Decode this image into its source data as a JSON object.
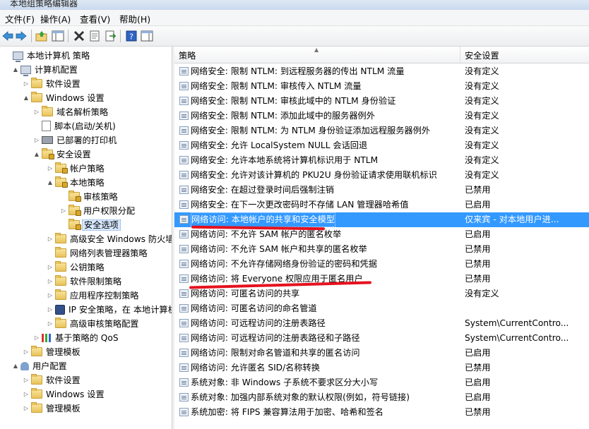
{
  "window": {
    "title": "本地组策略编辑器"
  },
  "menu": [
    "文件(F)",
    "操作(A)",
    "查看(V)",
    "帮助(H)"
  ],
  "toolbar_icons": [
    "back-arrow-icon",
    "forward-arrow-icon",
    "up-folder-icon",
    "show-tree-icon",
    "delete-icon",
    "properties-icon",
    "export-icon",
    "help-icon",
    "show-action-pane-icon"
  ],
  "tree": [
    {
      "label": "本地计算机 策略",
      "level": 0,
      "icon": "comp",
      "exp": ""
    },
    {
      "label": "计算机配置",
      "level": 1,
      "icon": "comp",
      "exp": "▲"
    },
    {
      "label": "软件设置",
      "level": 2,
      "icon": "folder",
      "exp": "▷"
    },
    {
      "label": "Windows 设置",
      "level": 2,
      "icon": "folder",
      "exp": "▲"
    },
    {
      "label": "域名解析策略",
      "level": 3,
      "icon": "folder",
      "exp": "▷"
    },
    {
      "label": "脚本(启动/关机)",
      "level": 3,
      "icon": "doc",
      "exp": ""
    },
    {
      "label": "已部署的打印机",
      "level": 3,
      "icon": "printer",
      "exp": "▷"
    },
    {
      "label": "安全设置",
      "level": 3,
      "icon": "lockf",
      "exp": "▲"
    },
    {
      "label": "帐户策略",
      "level": 4,
      "icon": "lockf",
      "exp": "▷"
    },
    {
      "label": "本地策略",
      "level": 4,
      "icon": "lockf",
      "exp": "▲"
    },
    {
      "label": "审核策略",
      "level": 5,
      "icon": "lockf",
      "exp": ""
    },
    {
      "label": "用户权限分配",
      "level": 5,
      "icon": "lockf",
      "exp": "▷"
    },
    {
      "label": "安全选项",
      "level": 5,
      "icon": "lockf",
      "exp": "",
      "selected": true
    },
    {
      "label": "高级安全 Windows 防火墙",
      "level": 4,
      "icon": "folder",
      "exp": "▷"
    },
    {
      "label": "网络列表管理器策略",
      "level": 4,
      "icon": "folder",
      "exp": ""
    },
    {
      "label": "公钥策略",
      "level": 4,
      "icon": "folder",
      "exp": "▷"
    },
    {
      "label": "软件限制策略",
      "level": 4,
      "icon": "folder",
      "exp": "▷"
    },
    {
      "label": "应用程序控制策略",
      "level": 4,
      "icon": "folder",
      "exp": "▷"
    },
    {
      "label": "IP 安全策略，在 本地计算机",
      "level": 4,
      "icon": "ipsec",
      "exp": "▷"
    },
    {
      "label": "高级审核策略配置",
      "level": 4,
      "icon": "folder",
      "exp": "▷"
    },
    {
      "label": "基于策略的 QoS",
      "level": 3,
      "icon": "chart",
      "exp": "▷"
    },
    {
      "label": "管理模板",
      "level": 2,
      "icon": "folder",
      "exp": "▷"
    },
    {
      "label": "用户配置",
      "level": 1,
      "icon": "user",
      "exp": "▲"
    },
    {
      "label": "软件设置",
      "level": 2,
      "icon": "folder",
      "exp": "▷"
    },
    {
      "label": "Windows 设置",
      "level": 2,
      "icon": "folder",
      "exp": "▷"
    },
    {
      "label": "管理模板",
      "level": 2,
      "icon": "folder",
      "exp": "▷"
    }
  ],
  "list": {
    "columns": [
      "策略",
      "安全设置"
    ],
    "rows": [
      {
        "policy": "网络安全: 限制 NTLM: 到远程服务器的传出 NTLM 流量",
        "setting": "没有定义"
      },
      {
        "policy": "网络安全: 限制 NTLM: 审核传入 NTLM 流量",
        "setting": "没有定义"
      },
      {
        "policy": "网络安全: 限制 NTLM: 审核此域中的 NTLM 身份验证",
        "setting": "没有定义"
      },
      {
        "policy": "网络安全: 限制 NTLM: 添加此域中的服务器例外",
        "setting": "没有定义"
      },
      {
        "policy": "网络安全: 限制 NTLM: 为 NTLM 身份验证添加远程服务器例外",
        "setting": "没有定义"
      },
      {
        "policy": "网络安全: 允许 LocalSystem NULL 会话回退",
        "setting": "没有定义"
      },
      {
        "policy": "网络安全: 允许本地系统将计算机标识用于 NTLM",
        "setting": "没有定义"
      },
      {
        "policy": "网络安全: 允许对该计算机的 PKU2U 身份验证请求使用联机标识",
        "setting": "没有定义"
      },
      {
        "policy": "网络安全: 在超过登录时间后强制注销",
        "setting": "已禁用"
      },
      {
        "policy": "网络安全: 在下一次更改密码时不存储 LAN 管理器哈希值",
        "setting": "已启用"
      },
      {
        "policy": "网络访问: 本地帐户的共享和安全模型",
        "setting": "仅来宾 - 对本地用户进...",
        "selected": true
      },
      {
        "policy": "网络访问: 不允许 SAM 帐户的匿名枚举",
        "setting": "已启用"
      },
      {
        "policy": "网络访问: 不允许 SAM 帐户和共享的匿名枚举",
        "setting": "已禁用"
      },
      {
        "policy": "网络访问: 不允许存储网络身份验证的密码和凭据",
        "setting": "已禁用"
      },
      {
        "policy": "网络访问: 将 Everyone 权限应用于匿名用户",
        "setting": "已禁用"
      },
      {
        "policy": "网络访问: 可匿名访问的共享",
        "setting": "没有定义"
      },
      {
        "policy": "网络访问: 可匿名访问的命名管道",
        "setting": ""
      },
      {
        "policy": "网络访问: 可远程访问的注册表路径",
        "setting": "System\\CurrentContro..."
      },
      {
        "policy": "网络访问: 可远程访问的注册表路径和子路径",
        "setting": "System\\CurrentContro..."
      },
      {
        "policy": "网络访问: 限制对命名管道和共享的匿名访问",
        "setting": "已启用"
      },
      {
        "policy": "网络访问: 允许匿名 SID/名称转换",
        "setting": "已禁用"
      },
      {
        "policy": "系统对象: 非 Windows 子系统不要求区分大小写",
        "setting": "已启用"
      },
      {
        "policy": "系统对象: 加强内部系统对象的默认权限(例如，符号链接)",
        "setting": "已启用"
      },
      {
        "policy": "系统加密: 将 FIPS 兼容算法用于加密、哈希和签名",
        "setting": "已禁用"
      }
    ]
  },
  "annotations": {
    "underline_color": "#e5121e"
  }
}
